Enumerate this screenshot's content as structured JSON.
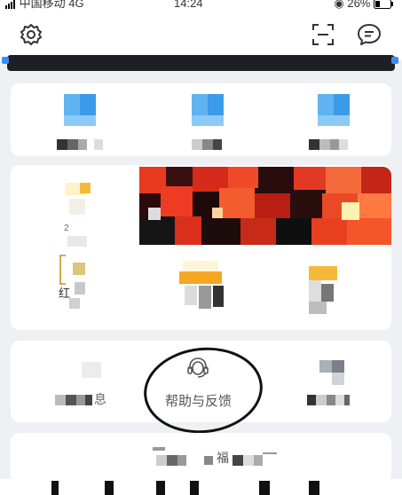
{
  "status_bar": {
    "carrier": "中国移动",
    "network": "4G",
    "time": "14:24",
    "battery": "26%"
  },
  "top_bar": {
    "settings_icon": "gear-icon",
    "scan_icon": "scan-icon",
    "message_icon": "chat-bubble-icon"
  },
  "menu": {
    "row4_left_fragment": "息",
    "help_feedback_label": "帮助与反馈",
    "help_feedback_icon": "headset-icon",
    "row5_fragment": "福"
  },
  "blocks_row2": {
    "left_fragment": "2"
  },
  "blocks_row3": {
    "left_fragment": "红"
  },
  "colors": {
    "page_bg": "#eef0f4",
    "card_bg": "#ffffff",
    "accent_blue": "#3b9be8",
    "annotation": "#111111"
  }
}
